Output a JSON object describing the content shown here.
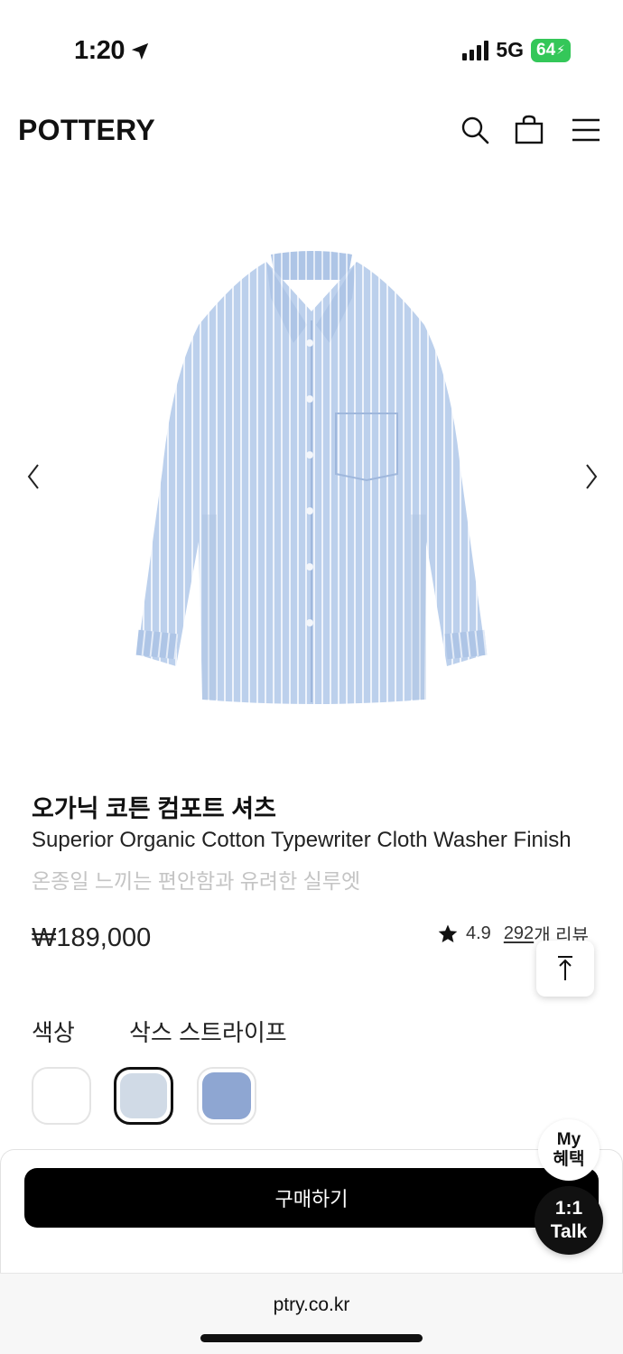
{
  "status_bar": {
    "time": "1:20",
    "network": "5G",
    "battery": "64"
  },
  "header": {
    "logo": "POTTERY",
    "icons": [
      "search-icon",
      "bag-icon",
      "menu-icon"
    ]
  },
  "product": {
    "title_ko": "오가닉 코튼 컴포트 셔츠",
    "subtitle_en": "Superior Organic Cotton Typewriter Cloth Washer Finish",
    "description_ko": "온종일 느끼는 편안함과 유려한 실루엣",
    "price": "₩189,000",
    "rating": "4.9",
    "review_count": "292",
    "review_suffix": "개 리뷰"
  },
  "options": {
    "color_label": "색상",
    "selected_color": "삭스 스트라이프",
    "swatches": [
      {
        "name": "white",
        "color": "#ffffff"
      },
      {
        "name": "sax-stripe",
        "color": "#d0dae6",
        "selected": true
      },
      {
        "name": "blue",
        "color": "#8ea6d2"
      }
    ]
  },
  "actions": {
    "buy_label": "구매하기",
    "my_benefit_line1": "My",
    "my_benefit_line2": "혜택",
    "talk_line1": "1:1",
    "talk_line2": "Talk"
  },
  "browser": {
    "url": "ptry.co.kr"
  },
  "colors": {
    "accent": "#000000",
    "shirt": "#bcd0ec",
    "muted_text": "#c4c4c4"
  }
}
